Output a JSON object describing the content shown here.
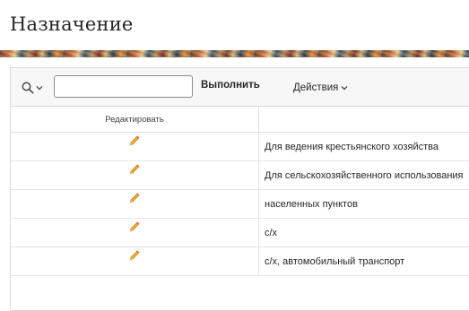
{
  "page": {
    "title": "Назначение"
  },
  "toolbar": {
    "search_value": "",
    "go_label": "Выполнить",
    "actions_label": "Действия"
  },
  "table": {
    "headers": {
      "edit": "Редактировать",
      "value": ""
    },
    "rows": [
      {
        "value": "Для ведения крестьянского хозяйства"
      },
      {
        "value": "Для сельскохозяйственного использования"
      },
      {
        "value": "населенных пунктов"
      },
      {
        "value": "с/х"
      },
      {
        "value": "с/х, автомобильный транспорт"
      }
    ]
  },
  "icons": {
    "search": "search-icon",
    "chevron": "chevron-down-icon",
    "edit": "pencil-icon"
  },
  "colors": {
    "pencil_body": "#f0a830",
    "pencil_tip": "#e9c7a0",
    "border": "#d9d9d9"
  }
}
